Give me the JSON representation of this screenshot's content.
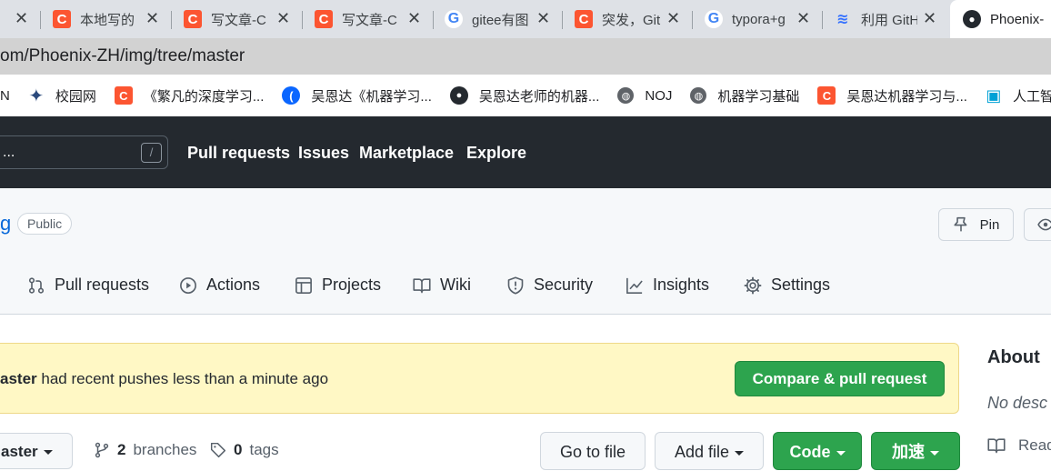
{
  "browser": {
    "tabs": [
      {
        "title": "本地写的",
        "icon": "csdn-icon"
      },
      {
        "title": "写文章-C",
        "icon": "csdn-icon"
      },
      {
        "title": "写文章-C",
        "icon": "csdn-icon"
      },
      {
        "title": "gitee有图",
        "icon": "google-icon"
      },
      {
        "title": "突发，Git",
        "icon": "csdn-icon"
      },
      {
        "title": "typora+g",
        "icon": "google-icon"
      },
      {
        "title": "利用 GitH",
        "icon": "lark-icon"
      },
      {
        "title": "Phoenix-",
        "icon": "github-icon"
      }
    ],
    "close_glyph": "✕",
    "address": "om/Phoenix-ZH/img/tree/master",
    "bookmarks": [
      {
        "label": "N",
        "icon": ""
      },
      {
        "label": "校园网",
        "icon": "campus-icon"
      },
      {
        "label": "《繁凡的深度学习...",
        "icon": "csdn-icon"
      },
      {
        "label": "吴恩达《机器学习...",
        "icon": "blue-leaf-icon"
      },
      {
        "label": "吴恩达老师的机器...",
        "icon": "github-icon"
      },
      {
        "label": "NOJ",
        "icon": "globe-icon"
      },
      {
        "label": "机器学习基础",
        "icon": "globe-icon"
      },
      {
        "label": "吴恩达机器学习与...",
        "icon": "csdn-icon"
      },
      {
        "label": "人工智",
        "icon": "bilibili-icon"
      }
    ]
  },
  "github": {
    "search_placeholder": "...",
    "search_shortcut": "/",
    "nav": [
      "Pull requests",
      "Issues",
      "Marketplace",
      "Explore"
    ]
  },
  "repo": {
    "name": "g",
    "visibility": "Public",
    "pin_label": "Pin",
    "tabs": [
      "Pull requests",
      "Actions",
      "Projects",
      "Wiki",
      "Security",
      "Insights",
      "Settings"
    ]
  },
  "flash": {
    "branch": "aster",
    "message": " had recent pushes less than a minute ago",
    "button": "Compare & pull request"
  },
  "sidebar": {
    "about": "About",
    "description": "No desc",
    "readme": "Read"
  },
  "filebar": {
    "branch": "aster",
    "branches_count": "2",
    "branches_label": "branches",
    "tags_count": "0",
    "tags_label": "tags",
    "goto_file": "Go to file",
    "add_file": "Add file",
    "code": "Code",
    "speed": "加速"
  }
}
